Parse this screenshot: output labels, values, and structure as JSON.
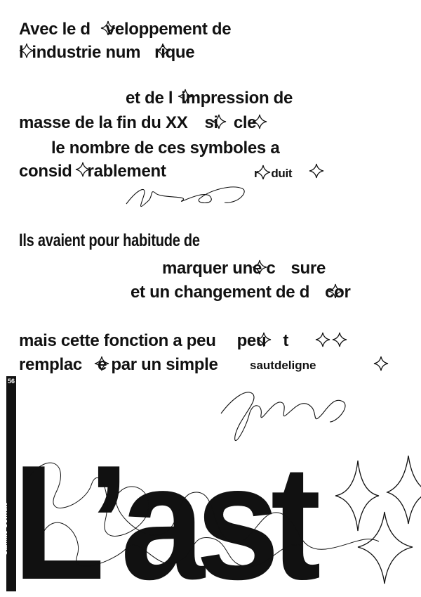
{
  "lines": [
    "Avec le développement de",
    "l’industrie numérique",
    "et de l’impression de",
    "masse de la fin du XXᵉ siècle",
    "le nombre de ces symboles a",
    "considérablement",
    "réduit",
    "Ils avaient pour habitude de",
    "marquer une césure",
    "et un changement de décor",
    "mais cette fonction a peu à peu été",
    "remplacée par un simple",
    "saut de ligne"
  ],
  "display": {
    "l1": "Avec le d",
    "l1b": "veloppement de",
    "l2a": "l",
    "l2b": "industrie num",
    "l2c": "rique",
    "l3a": "et de l",
    "l3b": "impression de",
    "l4a": "masse de la fin du XX",
    "l4b": "si",
    "l4c": "cle",
    "l5": "le nombre de ces symboles a",
    "l6a": "consid",
    "l6b": "rablement",
    "l7a": "r",
    "l7b": "duit",
    "l8": "Ils avaient pour habitude de",
    "l9a": "marquer une c",
    "l9b": "sure",
    "l10a": "et un changement de d",
    "l10b": "cor",
    "l11a": "mais cette fonction a peu",
    "l11b": "peu",
    "l11c": "t",
    "l12a": "remplac",
    "l12b": "e par un simple",
    "l13": "sautdeligne"
  },
  "title": "L’ast",
  "page_number": "56",
  "author": "Camille Ostwalt",
  "colors": {
    "ink": "#111111",
    "paper": "#ffffff"
  },
  "icons": [
    "asterism-star-outline",
    "handwritten-scribble"
  ]
}
